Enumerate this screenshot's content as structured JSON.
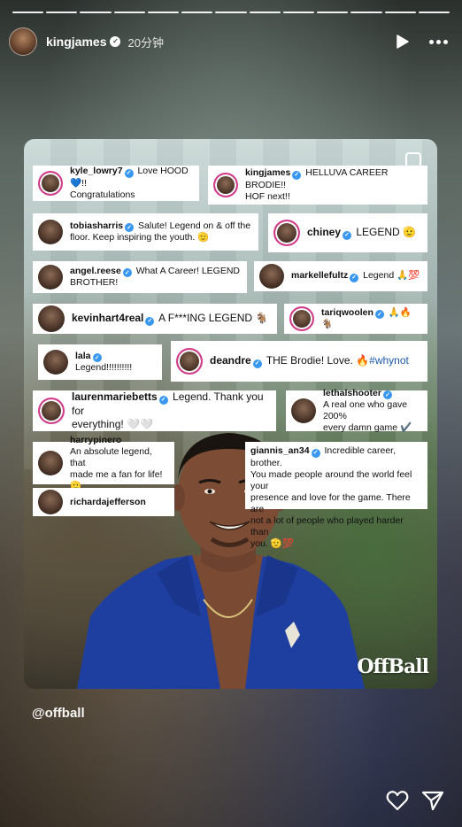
{
  "story": {
    "segment_count": 13,
    "username": "kingjames",
    "time_ago": "20分钟",
    "mention": "@offball"
  },
  "post": {
    "logo": "OffBall",
    "comments": [
      {
        "user": "kyle_lowry7",
        "text": "Love HOOD💙!!",
        "text2": "Congratulations"
      },
      {
        "user": "kingjames",
        "text": "HELLUVA CAREER BRODIE!!",
        "text2": "HOF next!!"
      },
      {
        "user": "tobiasharris",
        "text": "Salute! Legend on & off the",
        "text2": "floor. Keep inspiring the youth. 🫡"
      },
      {
        "user": "chiney",
        "text": "LEGEND 🫡"
      },
      {
        "user": "angel.reese",
        "text": "What A Career! LEGEND",
        "text2": "BROTHER!"
      },
      {
        "user": "markellefultz",
        "text": "Legend 🙏💯"
      },
      {
        "user": "kevinhart4real",
        "text": "A F***ING LEGEND 🐐"
      },
      {
        "user": "tariqwoolen",
        "text": "🙏🔥🐐"
      },
      {
        "user": "lala",
        "text": "Legend!!!!!!!!!!"
      },
      {
        "user": "deandre",
        "text": "THE Brodie! Love. 🔥",
        "tag": "#whynot"
      },
      {
        "user": "laurenmariebetts",
        "text": "Legend. Thank you for",
        "text2": "everything! 🤍🤍"
      },
      {
        "user": "lethalshooter",
        "text": "A real one who gave 200%",
        "text2": "every damn game ✔️"
      },
      {
        "user": "harrypinero",
        "text": "An absolute legend, that",
        "text2": "made me a fan for life! 🫡"
      },
      {
        "user": "giannis_an34",
        "text": "Incredible career, brother.",
        "text2": "You made people around the world feel your",
        "text3": "presence and love for the game. There are",
        "text4": "not a lot of people who played harder than",
        "text5": "you. 🫡💯"
      },
      {
        "user": "richardajefferson",
        "text": ""
      }
    ]
  },
  "icons": {
    "play": "play-icon",
    "more": "more-icon",
    "like": "heart-icon",
    "share": "send-icon",
    "copy": "carousel-icon"
  },
  "colors": {
    "verified": "#3897f0",
    "story_ring": "#d43b8b"
  }
}
